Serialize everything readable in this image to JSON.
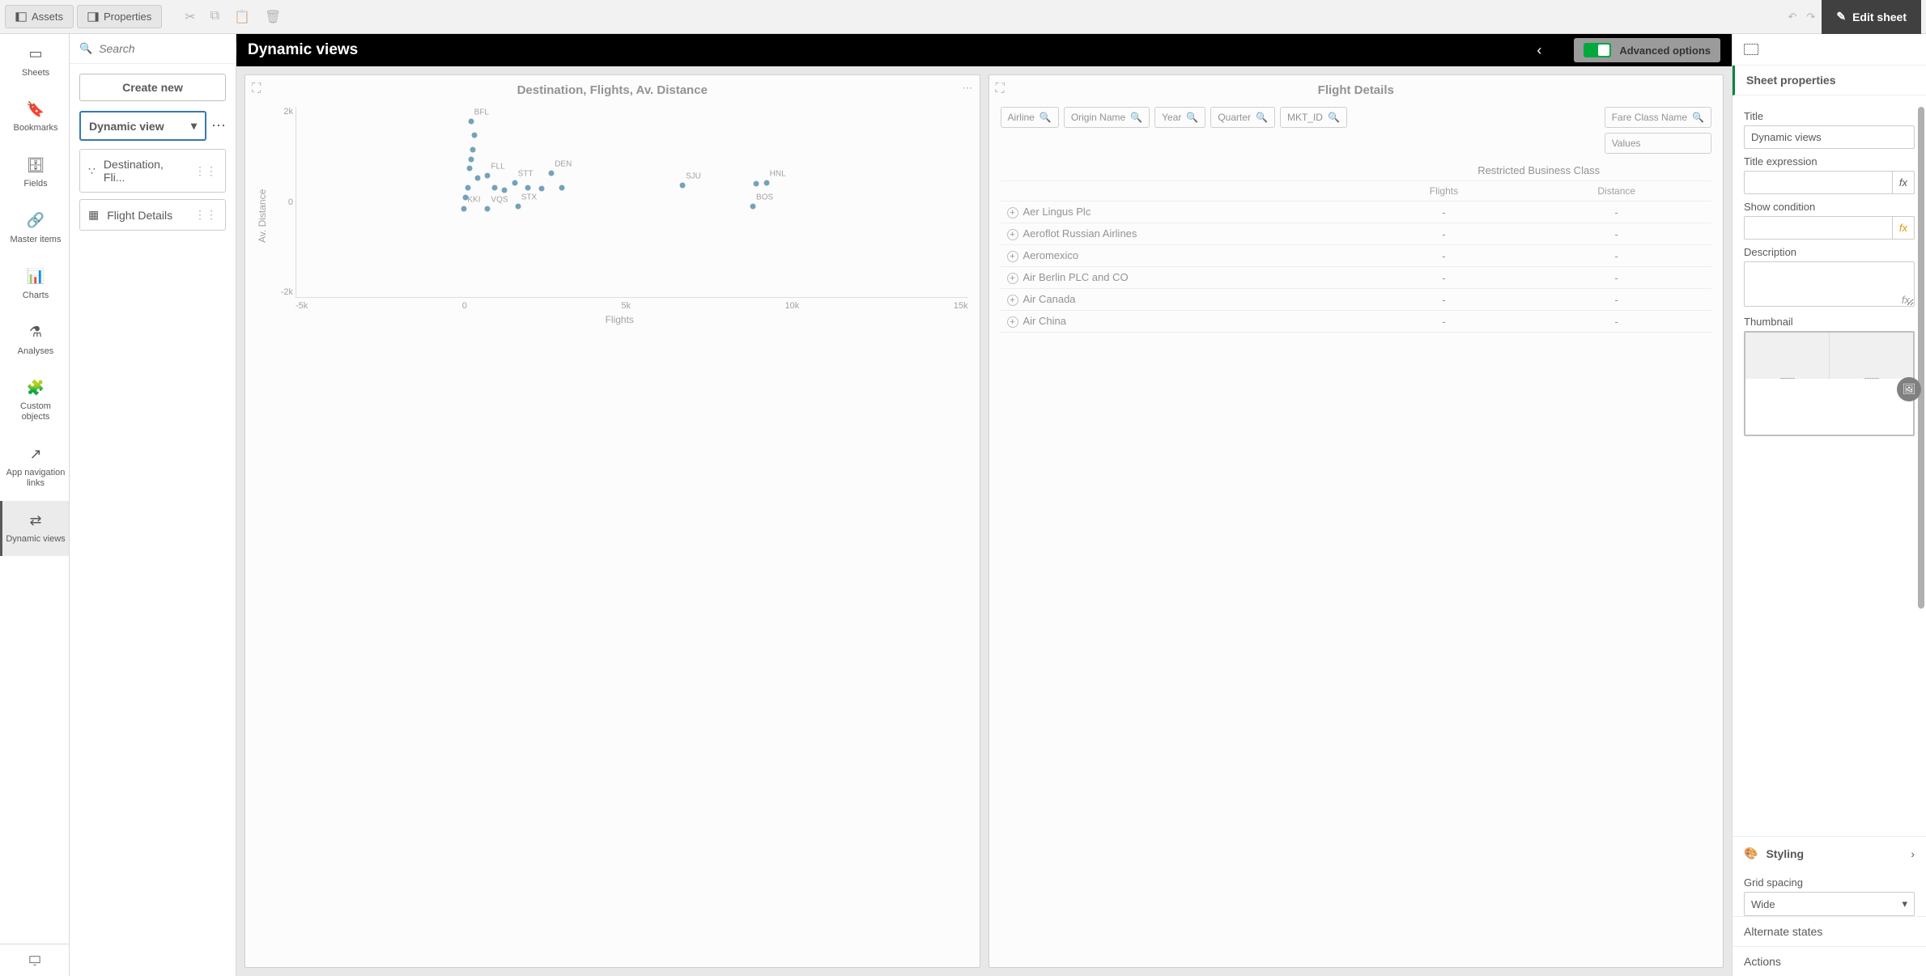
{
  "toolbar": {
    "assets_tab": "Assets",
    "properties_tab": "Properties",
    "edit_sheet": "Edit sheet"
  },
  "left_rail": {
    "items": [
      {
        "label": "Sheets"
      },
      {
        "label": "Bookmarks"
      },
      {
        "label": "Fields"
      },
      {
        "label": "Master items"
      },
      {
        "label": "Charts"
      },
      {
        "label": "Analyses"
      },
      {
        "label": "Custom objects"
      },
      {
        "label": "App navigation links"
      },
      {
        "label": "Dynamic views"
      }
    ]
  },
  "assets": {
    "search_placeholder": "Search",
    "create_new": "Create new",
    "dynamic_view_select": "Dynamic view",
    "items": [
      {
        "label": "Destination, Fli..."
      },
      {
        "label": "Flight Details"
      }
    ]
  },
  "sheet": {
    "title": "Dynamic views",
    "advanced_options": "Advanced options"
  },
  "chart1": {
    "title": "Destination, Flights, Av. Distance",
    "x_label": "Flights",
    "y_label": "Av. Distance"
  },
  "chart_data": {
    "type": "scatter",
    "title": "Destination, Flights, Av. Distance",
    "xlabel": "Flights",
    "ylabel": "Av. Distance",
    "xlim": [
      -5000,
      15000
    ],
    "ylim": [
      -2000,
      2000
    ],
    "x_ticks": [
      "-5k",
      "0",
      "5k",
      "10k",
      "15k"
    ],
    "y_ticks": [
      "2k",
      "0",
      "-2k"
    ],
    "points": [
      {
        "label": "BFL",
        "x": 200,
        "y": 1700
      },
      {
        "label": "FLL",
        "x": 700,
        "y": 550
      },
      {
        "label": "DEN",
        "x": 2600,
        "y": 600
      },
      {
        "label": "STT",
        "x": 1500,
        "y": 400
      },
      {
        "label": "SJU",
        "x": 6500,
        "y": 350
      },
      {
        "label": "HNL",
        "x": 9000,
        "y": 400
      },
      {
        "label": "KKI",
        "x": 0,
        "y": -150
      },
      {
        "label": "VQS",
        "x": 700,
        "y": -150
      },
      {
        "label": "STX",
        "x": 1600,
        "y": -100
      },
      {
        "label": "BOS",
        "x": 8600,
        "y": -100
      },
      {
        "label": "",
        "x": 300,
        "y": 1400
      },
      {
        "label": "",
        "x": 250,
        "y": 1100
      },
      {
        "label": "",
        "x": 200,
        "y": 900
      },
      {
        "label": "",
        "x": 150,
        "y": 700
      },
      {
        "label": "",
        "x": 400,
        "y": 500
      },
      {
        "label": "",
        "x": 100,
        "y": 300
      },
      {
        "label": "",
        "x": 50,
        "y": 100
      },
      {
        "label": "",
        "x": 900,
        "y": 300
      },
      {
        "label": "",
        "x": 1200,
        "y": 250
      },
      {
        "label": "",
        "x": 1900,
        "y": 300
      },
      {
        "label": "",
        "x": 2300,
        "y": 280
      },
      {
        "label": "",
        "x": 2900,
        "y": 300
      },
      {
        "label": "",
        "x": 8700,
        "y": 380
      }
    ]
  },
  "chart2": {
    "title": "Flight Details",
    "filters_left": [
      "Airline",
      "Origin Name",
      "Year",
      "Quarter",
      "MKT_ID"
    ],
    "filters_right_top": "Fare Class Name",
    "filters_right_bottom": "Values",
    "restricted_header": "Restricted Business Class",
    "sub_cols": [
      "Flights",
      "Distance"
    ],
    "rows": [
      {
        "name": "Aer Lingus Plc",
        "flights": "-",
        "distance": "-"
      },
      {
        "name": "Aeroflot Russian Airlines",
        "flights": "-",
        "distance": "-"
      },
      {
        "name": "Aeromexico",
        "flights": "-",
        "distance": "-"
      },
      {
        "name": "Air Berlin PLC and CO",
        "flights": "-",
        "distance": "-"
      },
      {
        "name": "Air Canada",
        "flights": "-",
        "distance": "-"
      },
      {
        "name": "Air China",
        "flights": "-",
        "distance": "-"
      }
    ]
  },
  "props": {
    "section": "Sheet properties",
    "title_label": "Title",
    "title_value": "Dynamic views",
    "title_expr_label": "Title expression",
    "show_cond_label": "Show condition",
    "desc_label": "Description",
    "thumb_label": "Thumbnail",
    "styling_label": "Styling",
    "grid_spacing_label": "Grid spacing",
    "grid_spacing_value": "Wide",
    "alt_states_label": "Alternate states",
    "actions_label": "Actions"
  }
}
